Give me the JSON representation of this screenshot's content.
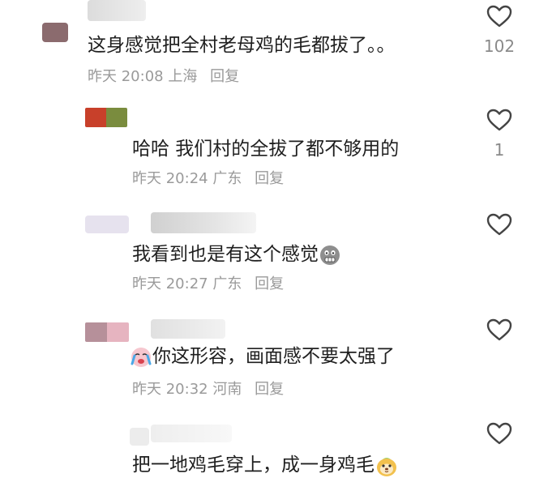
{
  "comments": [
    {
      "text": "这身感觉把全村老母鸡的毛都拔了。。",
      "time": "昨天 20:08",
      "location": "上海",
      "reply": "回复",
      "likes": "102",
      "avatar_colors": [
        "#8b6b6e",
        "#c9a9ad"
      ]
    },
    {
      "text": "哈哈 我们村的全拔了都不够用的",
      "time": "昨天 20:24",
      "location": "广东",
      "reply": "回复",
      "likes": "1",
      "avatar_colors": [
        "#c8402a",
        "#7a8c3e"
      ]
    },
    {
      "text": "我看到也是有这个感觉",
      "time": "昨天 20:27",
      "location": "广东",
      "reply": "回复",
      "likes": "",
      "emoji": "grimace-face-icon"
    },
    {
      "text": "你这形容，画面感不要太强了",
      "time": "昨天 20:32",
      "location": "河南",
      "reply": "回复",
      "likes": "",
      "emoji": "crying-face-icon"
    },
    {
      "text": "把一地鸡毛穿上，成一身鸡毛",
      "time": "",
      "location": "",
      "reply": "",
      "likes": "",
      "emoji": "cute-face-icon"
    }
  ]
}
